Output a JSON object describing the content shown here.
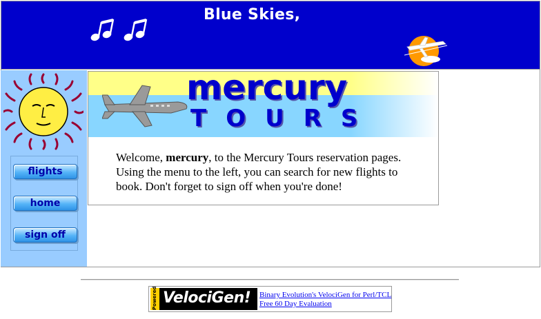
{
  "header": {
    "title": "Blue Skies,",
    "background": "#0000cc",
    "icons": [
      "music-notes-icon",
      "airplane-logo-icon"
    ]
  },
  "sidebar": {
    "background": "#99ccff",
    "logo_icon": "sun-face-icon",
    "nav": [
      {
        "label": "flights"
      },
      {
        "label": "home"
      },
      {
        "label": "sign off"
      }
    ]
  },
  "banner": {
    "word1": "mercury",
    "word2": "TOURS",
    "icon": "airplane-icon"
  },
  "welcome": {
    "prefix": "Welcome, ",
    "username": "mercury",
    "suffix": ", to the Mercury Tours reservation pages. Using the menu to the left, you can search for new flights to book. Don't forget to sign off when you're done!"
  },
  "footer_ad": {
    "badge": "Powered By",
    "brand": "VelociGen!",
    "link1": "Binary Evolution's VelociGen for Perl/TCL",
    "link2": "Free 60 Day Evaluation"
  }
}
